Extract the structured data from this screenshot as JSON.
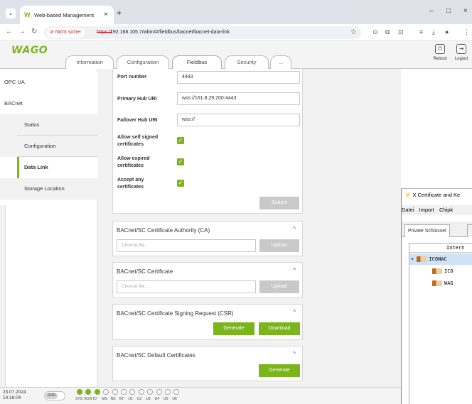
{
  "browser": {
    "tab_title": "Web-based Management",
    "url_secure_label": "Nicht sicher",
    "url_scheme": "https://",
    "url_rest": "192.168.105.7/wbm/#/fieldbus/bacnet/bacnet-data-link"
  },
  "header": {
    "logo": "WAGO",
    "tabs": [
      {
        "label": "Information"
      },
      {
        "label": "Configuration"
      },
      {
        "label": "Fieldbus"
      },
      {
        "label": "Security"
      },
      {
        "label": "..."
      }
    ],
    "reboot_label": "Reboot",
    "logout_label": "Logout"
  },
  "sidebar": {
    "items": [
      {
        "label": "OPC UA"
      },
      {
        "label": "BACnet"
      },
      {
        "label": "Status"
      },
      {
        "label": "Configuration"
      },
      {
        "label": "Data Link"
      },
      {
        "label": "Storage Location"
      }
    ]
  },
  "form": {
    "port_label": "Port number",
    "port_value": "4443",
    "primary_label": "Primary Hub URI",
    "primary_value": "wss://161.8.29.200:4443",
    "failover_label": "Failover Hub URI",
    "failover_value": "wss://",
    "self_signed_label": "Allow self signed certificates",
    "expired_label": "Allow expired certificates",
    "accept_any_label": "Accept any certificates",
    "checkbox_glyph": "✓",
    "submit_label": "Submit"
  },
  "panels": {
    "ca": {
      "title": "BACnet/SC Certificate Authority (CA)",
      "placeholder": "Choose file...",
      "upload": "Upload"
    },
    "cert": {
      "title": "BACnet/SC Certificate",
      "placeholder": "Choose file...",
      "upload": "Upload"
    },
    "csr": {
      "title": "BACnet/SC Certificate Signing Request (CSR)",
      "generate": "Generate",
      "download": "Download"
    },
    "default": {
      "title": "BACnet/SC Default Certificates",
      "generate": "Generate"
    }
  },
  "status": {
    "date": "23.07.2024",
    "time": "14:18:04",
    "run": "RUN",
    "leds": [
      {
        "label": "SYS",
        "on": true
      },
      {
        "label": "RUN",
        "on": true
      },
      {
        "label": "IO",
        "on": true
      },
      {
        "label": "MS",
        "on": false
      },
      {
        "label": "NS",
        "on": false
      },
      {
        "label": "BT",
        "on": false
      },
      {
        "label": "U1",
        "on": false
      },
      {
        "label": "U2",
        "on": false
      },
      {
        "label": "U3",
        "on": false
      },
      {
        "label": "U4",
        "on": false
      },
      {
        "label": "U5",
        "on": false
      },
      {
        "label": "U6",
        "on": false
      }
    ]
  },
  "java_window": {
    "title": "X Certificate and Ke",
    "menu": [
      "Datei",
      "Import",
      "Chipk"
    ],
    "tab": "Private Schlüssel",
    "column": "Intern",
    "rows": [
      "ICONAC",
      "ICO",
      "WAG"
    ]
  },
  "colors": {
    "brand": "#7ab51d",
    "disabled": "#c9c9c9"
  }
}
